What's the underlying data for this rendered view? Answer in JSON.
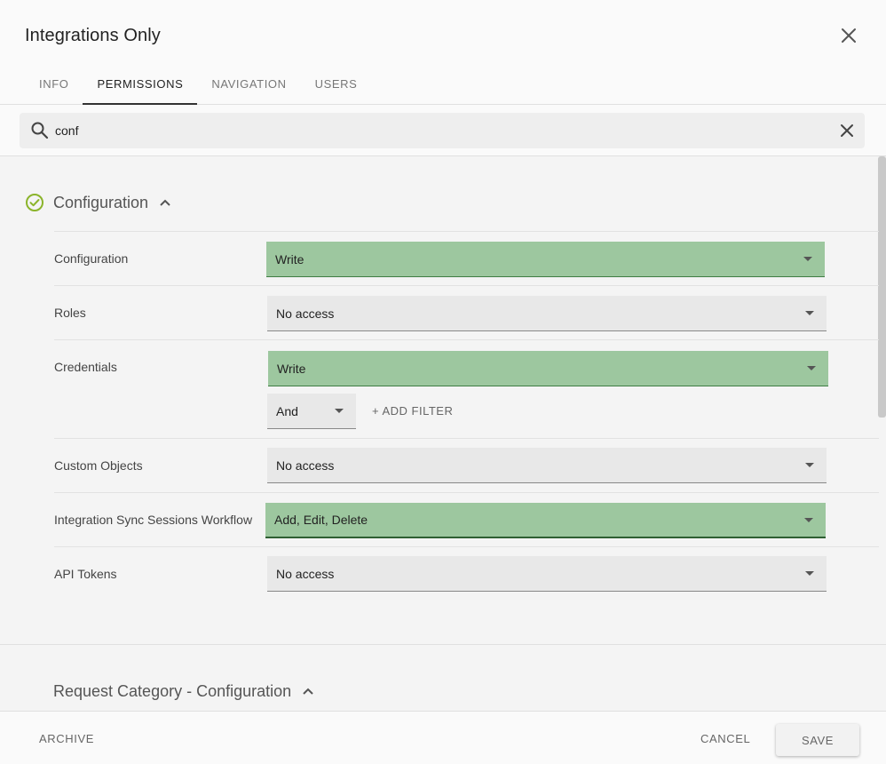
{
  "header": {
    "title": "Integrations Only",
    "tabs": [
      {
        "label": "INFO",
        "active": false
      },
      {
        "label": "PERMISSIONS",
        "active": true
      },
      {
        "label": "NAVIGATION",
        "active": false
      },
      {
        "label": "USERS",
        "active": false
      }
    ]
  },
  "search": {
    "value": "conf",
    "placeholder": "Search"
  },
  "section": {
    "title": "Configuration",
    "status_icon": "check-circle-icon",
    "status_color": "#8bb42b",
    "rows": [
      {
        "label": "Configuration",
        "value": "Write",
        "granted": true
      },
      {
        "label": "Roles",
        "value": "No access",
        "granted": false
      },
      {
        "label": "Credentials",
        "value": "Write",
        "granted": true,
        "filter_operator": "And",
        "add_filter_label": "+ ADD FILTER"
      },
      {
        "label": "Custom Objects",
        "value": "No access",
        "granted": false
      },
      {
        "label": "Integration Sync Sessions Workflow",
        "value": "Add, Edit, Delete",
        "granted": true
      },
      {
        "label": "API Tokens",
        "value": "No access",
        "granted": false
      }
    ]
  },
  "section2": {
    "title": "Request Category - Configuration"
  },
  "footer": {
    "archive_label": "ARCHIVE",
    "cancel_label": "CANCEL",
    "save_label": "SAVE"
  },
  "colors": {
    "granted_bg": "#9dc79f",
    "granted_underline": "#3f7d44"
  }
}
